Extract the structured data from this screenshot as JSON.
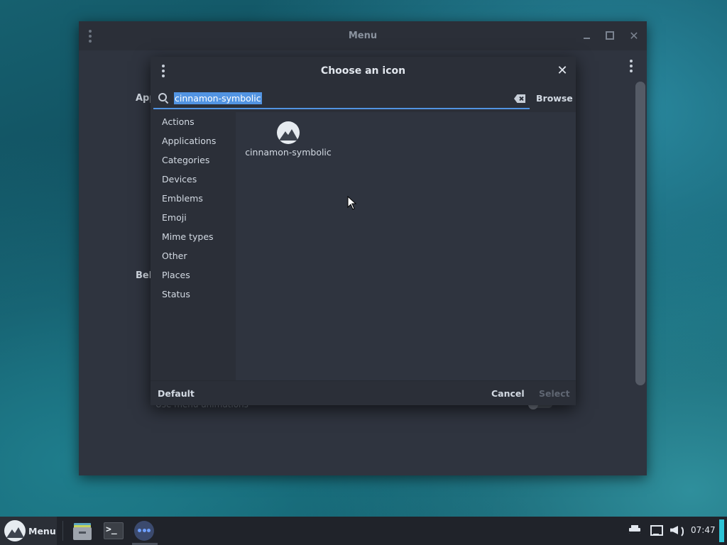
{
  "background_window": {
    "title": "Menu",
    "section_app_label": "App",
    "section_behavior_label": "Beh",
    "row_text": "Use menu animations"
  },
  "dialog": {
    "title": "Choose an icon",
    "search": {
      "value": "cinnamon-symbolic"
    },
    "browse_label": "Browse",
    "categories": [
      "Actions",
      "Applications",
      "Categories",
      "Devices",
      "Emblems",
      "Emoji",
      "Mime types",
      "Other",
      "Places",
      "Status"
    ],
    "results": [
      {
        "label": "cinnamon-symbolic",
        "icon": "cinnamon-logo-icon"
      }
    ],
    "footer": {
      "default_label": "Default",
      "cancel_label": "Cancel",
      "select_label": "Select"
    }
  },
  "taskbar": {
    "menu_label": "Menu",
    "apps": [
      "files-icon",
      "terminal-icon",
      "settings-icon"
    ],
    "tray": [
      "printer-icon",
      "network-icon",
      "volume-icon"
    ],
    "clock": "07:47"
  },
  "colors": {
    "accent": "#5294e2",
    "window_bg": "#2f343f",
    "header_bg": "#2b2f38",
    "panel_bg": "#20232a",
    "indicator": "#2ec4d6"
  }
}
